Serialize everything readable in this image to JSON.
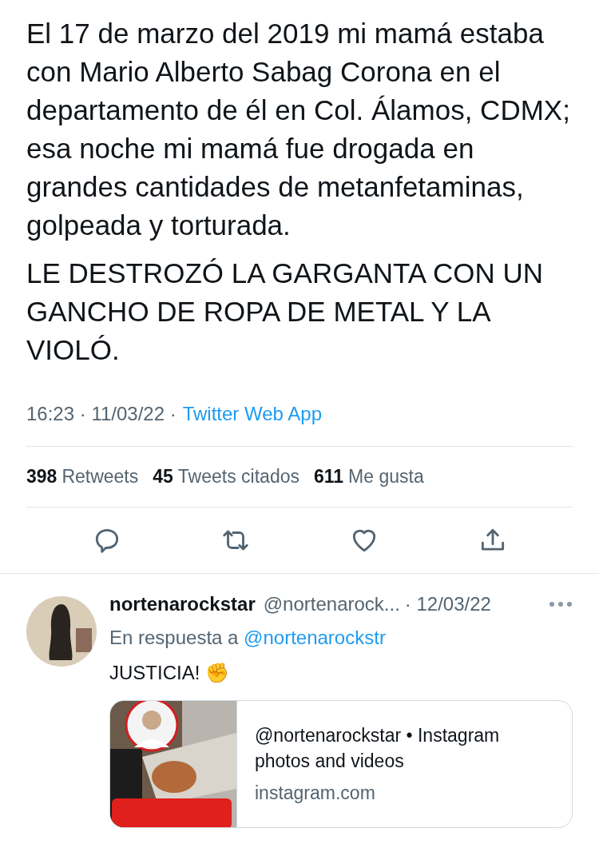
{
  "tweet": {
    "paragraphs": [
      "El 17 de marzo del 2019 mi mamá estaba con Mario Alberto Sabag Corona en el departamento de él en Col. Álamos, CDMX; esa noche mi mamá fue drogada en grandes cantidades de metanfetaminas, golpeada y torturada.",
      "LE DESTROZÓ LA GARGANTA CON UN GANCHO DE ROPA DE METAL Y LA VIOLÓ."
    ],
    "meta": "16:23 · 11/03/22 ·",
    "source": "Twitter Web App",
    "stats": [
      {
        "count": "398",
        "label": "Retweets"
      },
      {
        "count": "45",
        "label": "Tweets citados"
      },
      {
        "count": "611",
        "label": "Me gusta"
      }
    ],
    "actions": [
      {
        "kind": "reply"
      },
      {
        "kind": "retweet"
      },
      {
        "kind": "like"
      },
      {
        "kind": "share"
      }
    ]
  },
  "reply": {
    "name": "nortenarockstar",
    "handle": "@nortenarock...",
    "date": "· 12/03/22",
    "in_reply_prefix": "En respuesta a",
    "in_reply_to": "@nortenarockstr",
    "text": "JUSTICIA! ✊",
    "card": {
      "title": "@nortenarockstar • Instagram photos and videos",
      "domain": "instagram.com"
    }
  }
}
